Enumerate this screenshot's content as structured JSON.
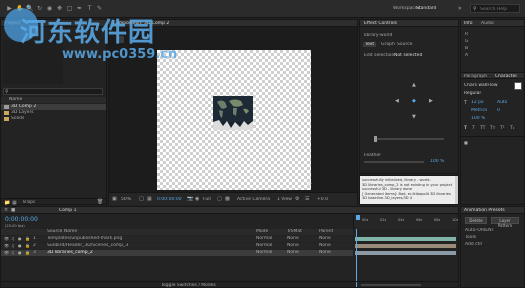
{
  "titlebar": {
    "workspace_label": "Standard",
    "search_placeholder": "Search Help",
    "ws_label": "Workspaces"
  },
  "watermark": {
    "cn": "河东软件园",
    "url": "www.pc0359.cn"
  },
  "project": {
    "tab": "Project",
    "search_placeholder": "",
    "col_name": "Name",
    "items": [
      {
        "name": "3D Comp 2",
        "color": "#9a9a9a",
        "selected": true
      },
      {
        "name": "3D Layers",
        "color": "#c8a85a",
        "selected": false
      },
      {
        "name": "Solids",
        "color": "#c8a85a",
        "selected": false
      }
    ],
    "bpc": "8 bpc"
  },
  "composition": {
    "tab": "Composition: 3D Comp 2",
    "zoom": "50%",
    "timecode": "0:00:00:00",
    "resolution": "Full",
    "camera": "Active Camera",
    "view": "1 View",
    "offset": "+0.0"
  },
  "effect_controls": {
    "tab": "Effect Controls",
    "layer": "library-world",
    "tabs": [
      "Text",
      "Graph",
      "Source"
    ],
    "info_rows": [
      "Edit selection",
      "Not selected"
    ],
    "footer_label": "Feather",
    "footer_value": "100 %"
  },
  "info_panel": {
    "lines": [
      "successfully initialized, library - world-",
      "3D libraries_comp_2 is not existing in your project",
      "successful 3D - library done",
      "[ Generated items]: Bad, er-Ikibapolit 3D libraries",
      "3D baseline-3D_layers/3D 4"
    ]
  },
  "right_panel": {
    "top_tabs": [
      "Info",
      "Audio"
    ],
    "color_labels": [
      "R",
      "G",
      "B",
      "A"
    ],
    "char_tabs": [
      "Paragraph",
      "Character"
    ],
    "font": "Chars wallFlow",
    "style": "Regular",
    "size": "12 px",
    "leading": "Auto",
    "tracking": "0",
    "metrics": "Metrics",
    "extra": "100 %",
    "lower_tab": "Animation Presets",
    "lower_rows": [
      "Auto-ORIENT",
      "Tools",
      "Add ctrl"
    ],
    "lower_btns": [
      "Delete",
      "Layer Pattern"
    ]
  },
  "timeline": {
    "tab": "Comp 1",
    "timecode": "0:00:00:00",
    "fps": "(25.00 fps)",
    "col_source": "Source Name",
    "col_mode": "Mode",
    "col_trkmat": "TrkMat",
    "col_parent": "Parent",
    "layers": [
      {
        "num": "1",
        "name": "Templates/unpublished-mark.png",
        "mode": "Normal",
        "trkmat": "None",
        "parent": "None",
        "bar": "#7fb3a8"
      },
      {
        "num": "2",
        "name": "Sunbird/Header_3D/Scenes_comp_3",
        "mode": "Normal",
        "trkmat": "None",
        "parent": "None",
        "bar": "#9a8c78"
      },
      {
        "num": "3",
        "name": "3D libraries_comp_2",
        "mode": "Normal",
        "trkmat": "None",
        "parent": "None",
        "bar": "#8c9aa8",
        "selected": true
      }
    ],
    "ruler": [
      "00s",
      "02s",
      "04s",
      "06s",
      "08s",
      "10s"
    ],
    "footer": "Toggle Switches / Modes"
  }
}
